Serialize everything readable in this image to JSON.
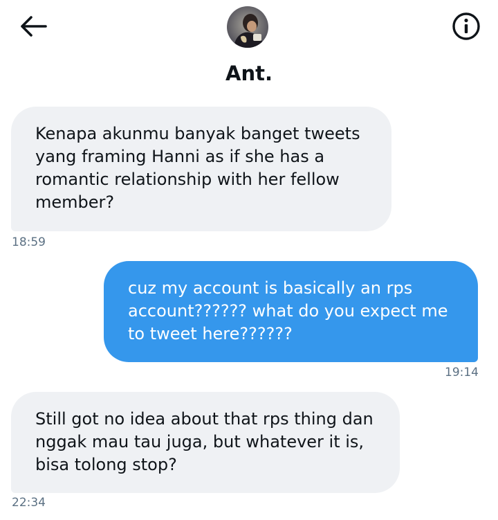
{
  "header": {
    "back_icon": "arrow-left-icon",
    "info_icon": "info-circle-icon",
    "avatar_icon": "profile-photo",
    "contact_name": "Ant."
  },
  "colors": {
    "sent_bubble": "#3597ec",
    "received_bubble": "#eff1f4",
    "text": "#0f1419",
    "timestamp": "#5b7083"
  },
  "messages": [
    {
      "direction": "received",
      "lines": [
        "Kenapa akunmu banyak banget tweets",
        "yang framing Hanni as if she has a",
        "romantic relationship with her fellow",
        "member?"
      ],
      "time": "18:59"
    },
    {
      "direction": "sent",
      "lines": [
        "cuz my account is basically an rps",
        "account?????? what do you expect me",
        "to tweet here??????"
      ],
      "time": "19:14"
    },
    {
      "direction": "received",
      "lines": [
        "Still got no idea about that rps thing dan",
        "nggak mau tau juga, but whatever it is,",
        "bisa tolong stop?"
      ],
      "time": "22:34"
    }
  ]
}
